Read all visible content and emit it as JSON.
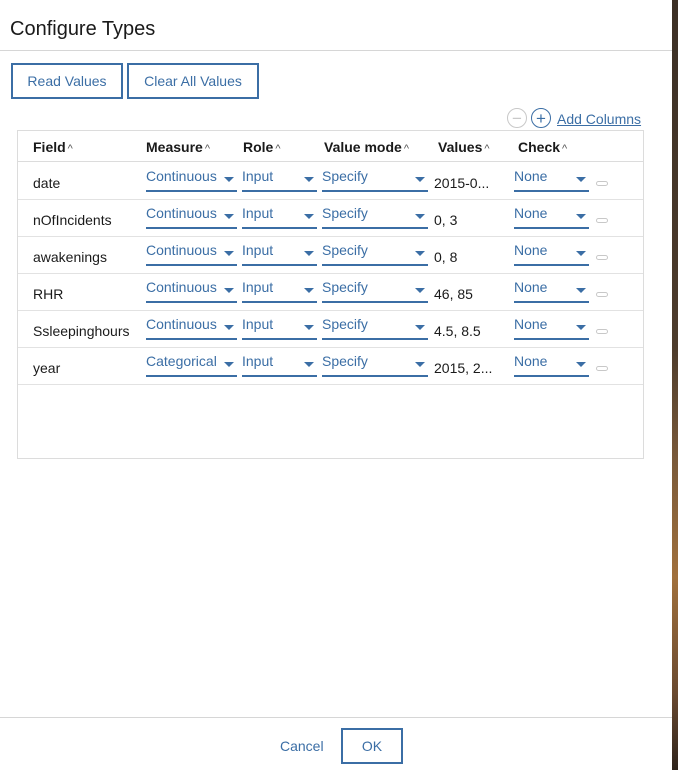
{
  "dialog": {
    "title": "Configure Types",
    "read_values_label": "Read Values",
    "clear_all_label": "Clear All Values",
    "add_columns_label": "Add Columns",
    "cancel_label": "Cancel",
    "ok_label": "OK"
  },
  "table": {
    "headers": {
      "field": "Field",
      "measure": "Measure",
      "role": "Role",
      "value_mode": "Value mode",
      "values": "Values",
      "check": "Check"
    },
    "rows": [
      {
        "field": "date",
        "measure": "Continuous",
        "role": "Input",
        "value_mode": "Specify",
        "values": "2015-0...",
        "check": "None"
      },
      {
        "field": "nOfIncidents",
        "measure": "Continuous",
        "role": "Input",
        "value_mode": "Specify",
        "values": "0, 3",
        "check": "None"
      },
      {
        "field": "awakenings",
        "measure": "Continuous",
        "role": "Input",
        "value_mode": "Specify",
        "values": "0, 8",
        "check": "None"
      },
      {
        "field": "RHR",
        "measure": "Continuous",
        "role": "Input",
        "value_mode": "Specify",
        "values": "46, 85",
        "check": "None"
      },
      {
        "field": "Ssleepinghours",
        "measure": "Continuous",
        "role": "Input",
        "value_mode": "Specify",
        "values": "4.5, 8.5",
        "check": "None"
      },
      {
        "field": "year",
        "measure": "Categorical",
        "role": "Input",
        "value_mode": "Specify",
        "values": "2015, 2...",
        "check": "None"
      }
    ]
  },
  "colors": {
    "accent": "#3b6ea5",
    "border": "#dcdcdc",
    "text": "#1a1a1a"
  }
}
